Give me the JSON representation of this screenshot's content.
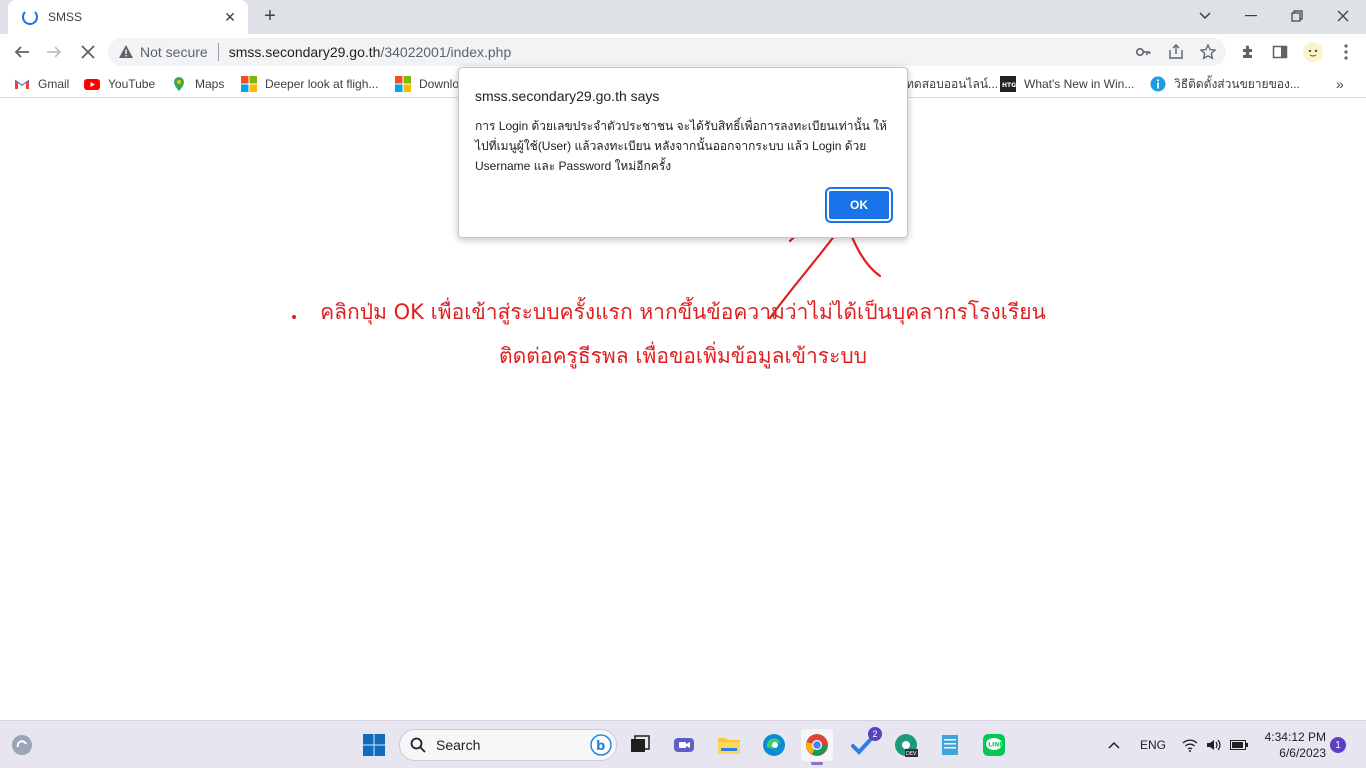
{
  "tab": {
    "title": "SMSS",
    "close": "✕",
    "new": "+"
  },
  "toolbar": {
    "security_label": "Not secure",
    "url_host": "smss.secondary29.go.th",
    "url_path": "/34022001/index.php"
  },
  "bookmarks": [
    {
      "label": "Gmail",
      "icon": "gmail-icon"
    },
    {
      "label": "YouTube",
      "icon": "youtube-icon"
    },
    {
      "label": "Maps",
      "icon": "maps-icon"
    },
    {
      "label": "Deeper look at fligh...",
      "icon": "microsoft-icon"
    },
    {
      "label": "Downlo",
      "icon": "microsoft-icon"
    },
    {
      "label": "ทดสอบออนไลน์...",
      "icon": "web-icon"
    },
    {
      "label": "What's New in Win...",
      "icon": "htg-icon"
    },
    {
      "label": "วิธีติดตั้งส่วนขยายของ...",
      "icon": "info-icon"
    }
  ],
  "dialog": {
    "title": "smss.secondary29.go.th says",
    "message": "การ Login ด้วยเลขประจำตัวประชาชน จะได้รับสิทธิ์เพื่อการลงทะเบียนเท่านั้น ให้ไปที่เมนูผู้ใช้(User) แล้วลงทะเบียน หลังจากนั้นออกจากระบบ แล้ว Login ด้วย Username และ Password ใหม่อีกครั้ง",
    "ok_label": "OK"
  },
  "annotation": {
    "line1": "คลิกปุ่ม OK เพื่อเข้าสู่ระบบครั้งแรก หากขึ้นข้อความว่าไม่ได้เป็นบุคลากรโรงเรียน",
    "line2": "ติดต่อครูธีรพล เพื่อขอเพิ่มข้อมูลเข้าระบบ",
    "color": "#e02020"
  },
  "taskbar": {
    "search_label": "Search",
    "language": "ENG",
    "time": "4:34:12 PM",
    "date": "6/6/2023",
    "notification_count": "1",
    "todo_badge": "2"
  }
}
